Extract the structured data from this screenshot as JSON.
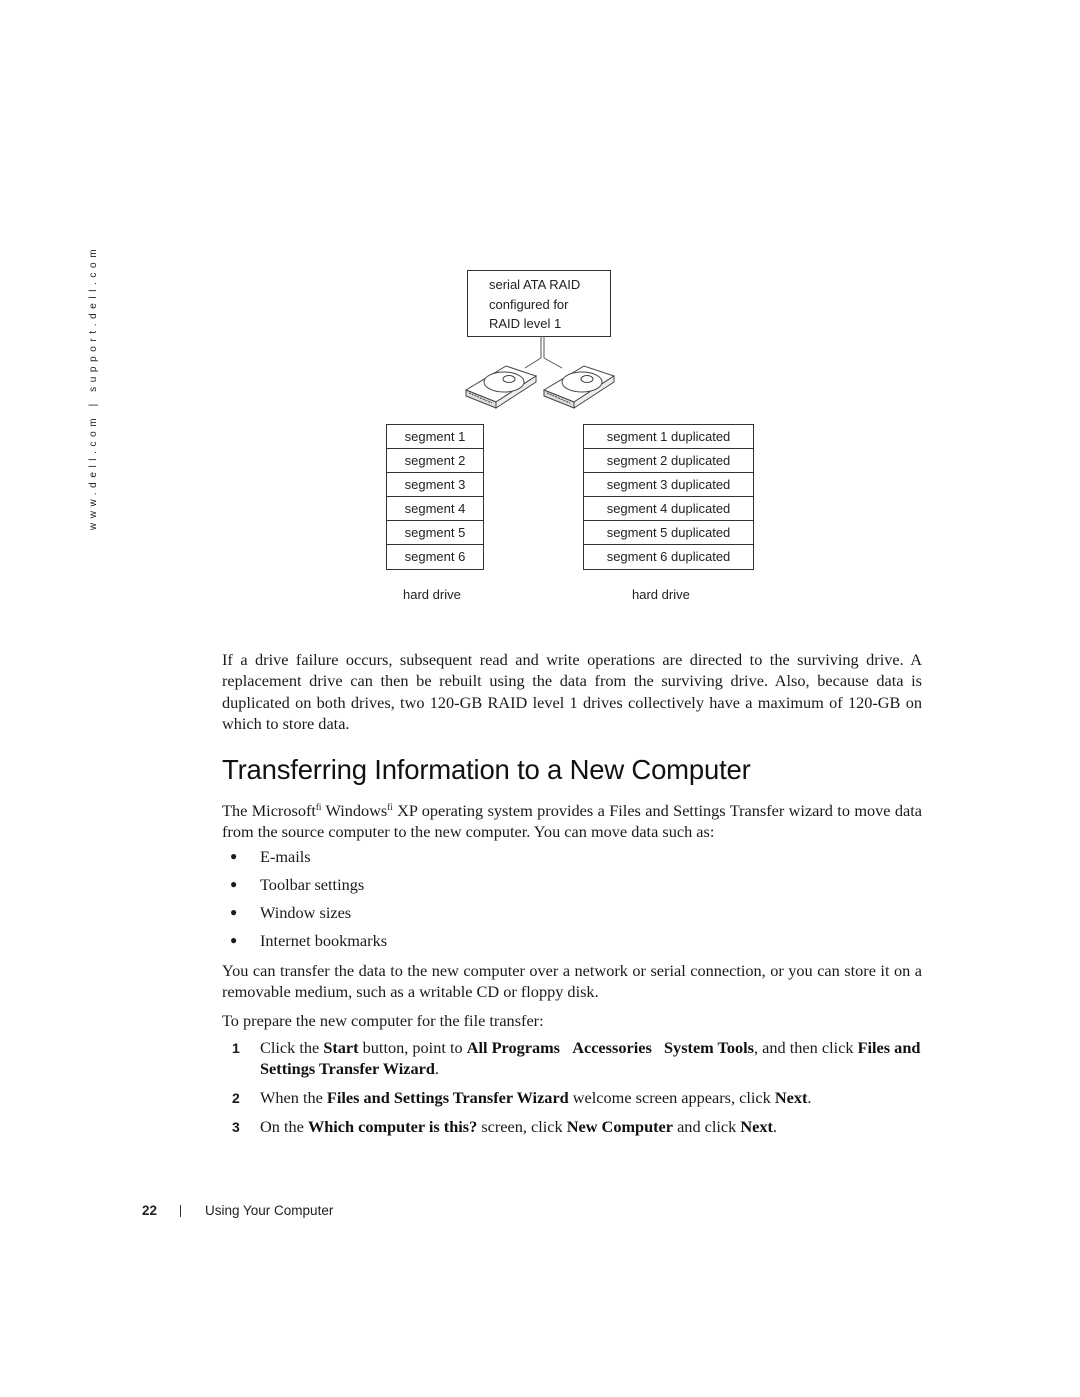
{
  "margin": {
    "site_url": "www.dell.com | support.dell.com"
  },
  "diagram": {
    "controller_label": [
      "serial ATA RAID",
      "configured for",
      "RAID level 1"
    ],
    "left_drive": {
      "segments": [
        "segment 1",
        "segment 2",
        "segment 3",
        "segment 4",
        "segment 5",
        "segment 6"
      ],
      "label": "hard drive"
    },
    "right_drive": {
      "segments": [
        "segment 1 duplicated",
        "segment 2 duplicated",
        "segment 3 duplicated",
        "segment 4 duplicated",
        "segment 5 duplicated",
        "segment 6 duplicated"
      ],
      "label": "hard drive"
    },
    "icons": [
      "hard-drive-icon",
      "hard-drive-icon"
    ]
  },
  "body": {
    "failure_paragraph": "If a drive failure occurs, subsequent read and write operations are directed to the surviving drive. A replacement drive can then be rebuilt using the data from the surviving drive. Also, because data is duplicated on both drives, two 120-GB RAID level 1 drives collectively have a maximum of 120-GB on which to store data.",
    "heading": "Transferring Information to a New Computer",
    "intro": {
      "part1": "The Microsoft",
      "sup1": "fi",
      "part2": " Windows",
      "sup2": "fi",
      "part3": " XP operating system provides a Files and Settings Transfer wizard to move data from the source computer to the new computer. You can move data such as:"
    },
    "bullets": [
      "E-mails",
      "Toolbar settings",
      "Window sizes",
      "Internet bookmarks"
    ],
    "transfer_paragraph": "You can transfer the data to the new computer over a network or serial connection, or you can store it on a removable medium, such as a writable CD or floppy disk.",
    "prepare_paragraph": "To prepare the new computer for the file transfer:",
    "steps": [
      {
        "num": "1",
        "t1": "Click the ",
        "b1": "Start",
        "t2": " button, point to ",
        "b2": "All Programs",
        "t3": "   ",
        "b3": "Accessories",
        "t4": "   ",
        "b4": "System Tools",
        "t5": ", and then click ",
        "b5": "Files and Settings Transfer Wizard",
        "t6": "."
      },
      {
        "num": "2",
        "t1": "When the ",
        "b1": "Files and Settings Transfer Wizard",
        "t2": " welcome screen appears, click ",
        "b2": "Next",
        "t3": "."
      },
      {
        "num": "3",
        "t1": "On the ",
        "b1": "Which computer is this?",
        "t2": " screen, click ",
        "b2": "New Computer",
        "t3": " and click ",
        "b3": "Next",
        "t4": "."
      }
    ]
  },
  "footer": {
    "page_number": "22",
    "section": "Using Your Computer"
  }
}
